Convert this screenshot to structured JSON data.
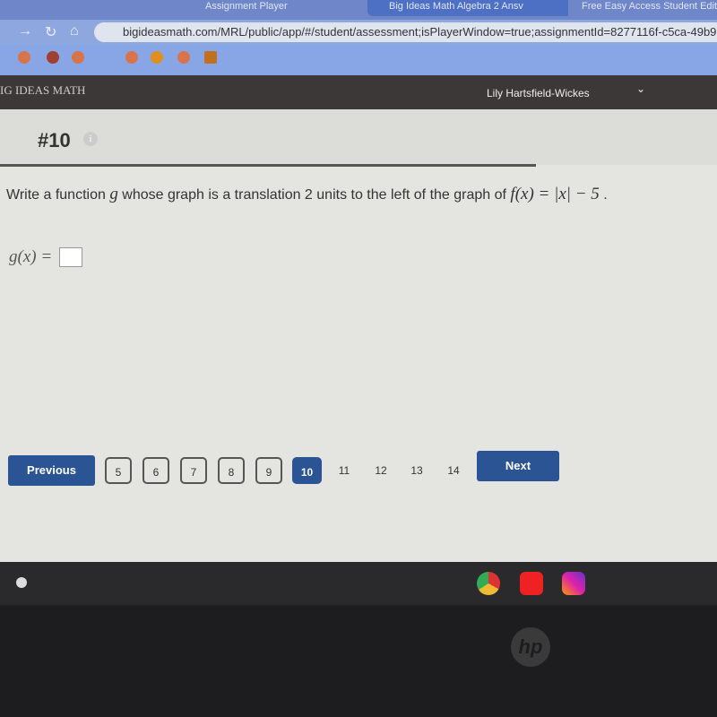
{
  "browser": {
    "tabs": [
      "Assignment Player",
      "Big Ideas Math Algebra 2 Ansv",
      "Free Easy Access Student Edit"
    ],
    "url": "bigideasmath.com/MRL/public/app/#/student/assessment;isPlayerWindow=true;assignmentId=8277116f-c5ca-49b9"
  },
  "app": {
    "brand": "IG IDEAS MATH",
    "user": "Lily Hartsfield-Wickes",
    "chevron": "⌄"
  },
  "question": {
    "number": "#10",
    "info": "i",
    "text_pre": "Write a function ",
    "var": "g",
    "text_mid": " whose graph is a translation 2 units to the left of the graph of ",
    "func": "f(x) = |x| − 5",
    "end": " .",
    "answer_label": "g(x) =",
    "answer_value": ""
  },
  "pagination": {
    "previous": "Previous",
    "next": "Next",
    "pages": [
      "5",
      "6",
      "7",
      "8",
      "9",
      "10",
      "11",
      "12",
      "13",
      "14"
    ],
    "current": "10"
  }
}
